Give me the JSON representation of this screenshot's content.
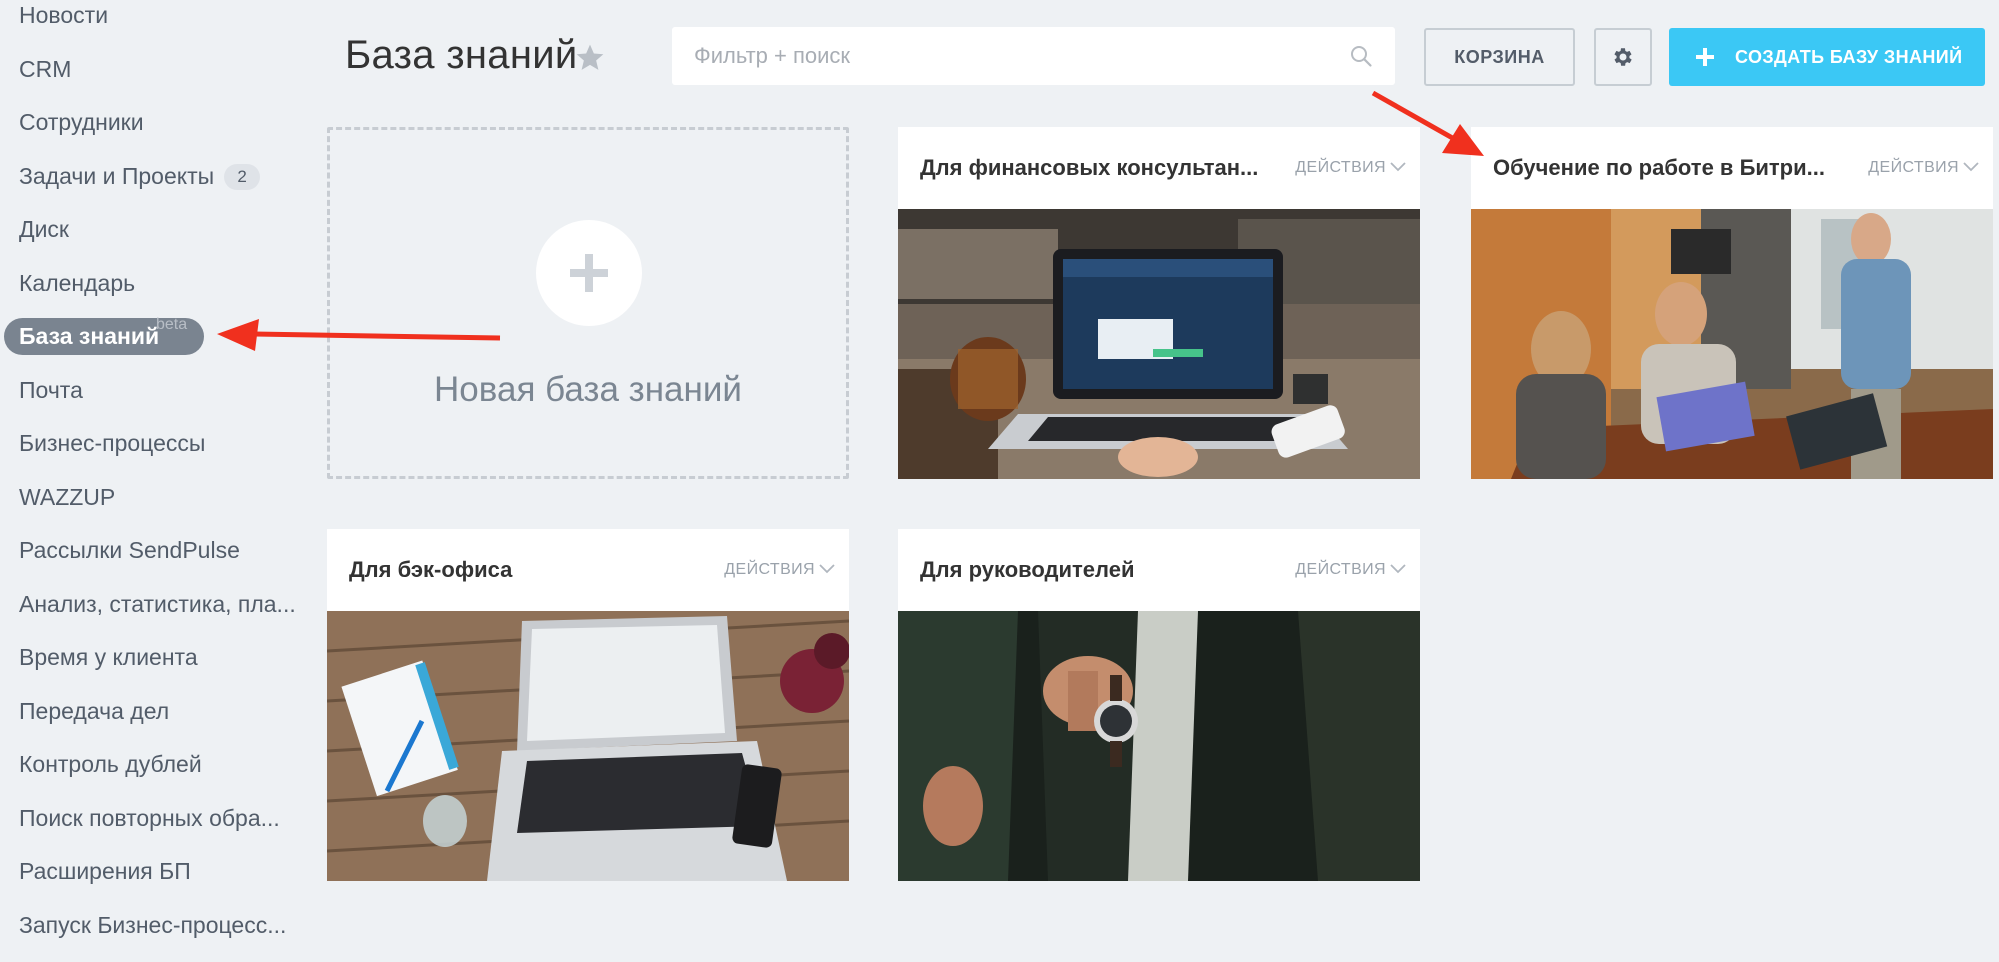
{
  "sidebar": {
    "items": [
      {
        "label": "Новости"
      },
      {
        "label": "CRM"
      },
      {
        "label": "Сотрудники"
      },
      {
        "label": "Задачи и Проекты",
        "count": "2"
      },
      {
        "label": "Диск"
      },
      {
        "label": "Календарь"
      },
      {
        "label": "База знаний",
        "badge": "beta",
        "active": true
      },
      {
        "label": "Почта"
      },
      {
        "label": "Бизнес-процессы"
      },
      {
        "label": "WAZZUP"
      },
      {
        "label": "Рассылки SendPulse"
      },
      {
        "label": "Анализ, статистика, пла..."
      },
      {
        "label": "Время у клиента"
      },
      {
        "label": "Передача дел"
      },
      {
        "label": "Контроль дублей"
      },
      {
        "label": "Поиск повторных обра..."
      },
      {
        "label": "Расширения БП"
      },
      {
        "label": "Запуск Бизнес-процесс..."
      }
    ]
  },
  "header": {
    "title": "База знаний",
    "title_icon": "star-icon",
    "search": {
      "placeholder": "Фильтр + поиск",
      "value": "",
      "icon": "search-icon"
    },
    "trash_label": "КОРЗИНА",
    "settings_icon": "gear-icon",
    "create_label": "СОЗДАТЬ БАЗУ ЗНАНИЙ"
  },
  "new_card": {
    "label": "Новая база знаний",
    "icon": "plus-icon"
  },
  "cards": [
    {
      "title": "Для финансовых консультан...",
      "actions": "ДЕЙСТВИЯ",
      "photo": "laptop-revenue-photo"
    },
    {
      "title": "Обучение по работе в Битри...",
      "actions": "ДЕЙСТВИЯ",
      "photo": "office-meeting-photo"
    },
    {
      "title": "Для бэк-офиса",
      "actions": "ДЕЙСТВИЯ",
      "photo": "desk-laptop-photo"
    },
    {
      "title": "Для руководителей",
      "actions": "ДЕЙСТВИЯ",
      "photo": "man-watch-photo"
    }
  ],
  "colors": {
    "background": "#eef1f4",
    "accent_blue": "#3bc8f5",
    "annotation_arrow": "#f0301e",
    "active_pill": "#7a8490"
  }
}
